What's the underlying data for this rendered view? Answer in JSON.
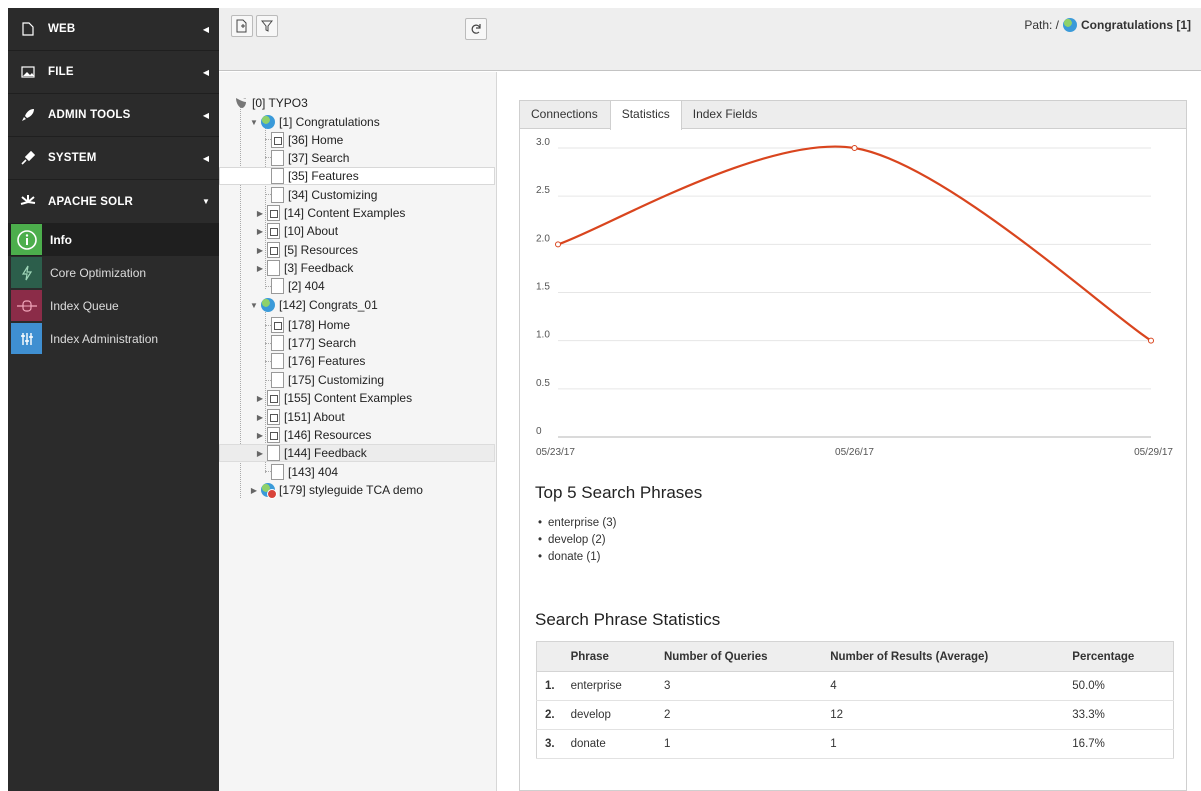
{
  "sidebar": {
    "groups": [
      {
        "label": "WEB",
        "icon": "page-icon"
      },
      {
        "label": "FILE",
        "icon": "image-icon"
      },
      {
        "label": "ADMIN TOOLS",
        "icon": "rocket-icon"
      },
      {
        "label": "SYSTEM",
        "icon": "plug-icon"
      },
      {
        "label": "APACHE SOLR",
        "icon": "solr-icon"
      }
    ],
    "items": [
      {
        "label": "Info",
        "color": "#4cae4c"
      },
      {
        "label": "Core Optimization",
        "color": "#2c5e4b"
      },
      {
        "label": "Index Queue",
        "color": "#8b2c48"
      },
      {
        "label": "Index Administration",
        "color": "#3f8fd1"
      }
    ]
  },
  "header": {
    "path_label": "Path: /",
    "path_page": "Congratulations [1]"
  },
  "tree": {
    "root": "[0] TYPO3",
    "nodes": [
      "[1] Congratulations",
      "[36] Home",
      "[37] Search",
      "[35] Features",
      "[34] Customizing",
      "[14] Content Examples",
      "[10] About",
      "[5] Resources",
      "[3] Feedback",
      "[2] 404",
      "[142] Congrats_01",
      "[178] Home",
      "[177] Search",
      "[176] Features",
      "[175] Customizing",
      "[155] Content Examples",
      "[151] About",
      "[146] Resources",
      "[144] Feedback",
      "[143] 404",
      "[179] styleguide TCA demo"
    ]
  },
  "tabs": [
    "Connections",
    "Statistics",
    "Index Fields"
  ],
  "chart_data": {
    "type": "line",
    "x": [
      "05/23/17",
      "05/26/17",
      "05/29/17"
    ],
    "values": [
      2.0,
      3.0,
      1.0
    ],
    "yticks": [
      "0",
      "0.5",
      "1.0",
      "1.5",
      "2.0",
      "2.5",
      "3.0"
    ],
    "ylim": [
      0,
      3
    ],
    "grid": true,
    "color": "#d9451e"
  },
  "top5": {
    "title": "Top 5 Search Phrases",
    "items": [
      "enterprise (3)",
      "develop (2)",
      "donate (1)"
    ]
  },
  "stats": {
    "title": "Search Phrase Statistics",
    "headers": [
      "",
      "Phrase",
      "Number of Queries",
      "Number of Results (Average)",
      "Percentage"
    ],
    "rows": [
      [
        "1.",
        "enterprise",
        "3",
        "4",
        "50.0%"
      ],
      [
        "2.",
        "develop",
        "2",
        "12",
        "33.3%"
      ],
      [
        "3.",
        "donate",
        "1",
        "1",
        "16.7%"
      ]
    ]
  }
}
